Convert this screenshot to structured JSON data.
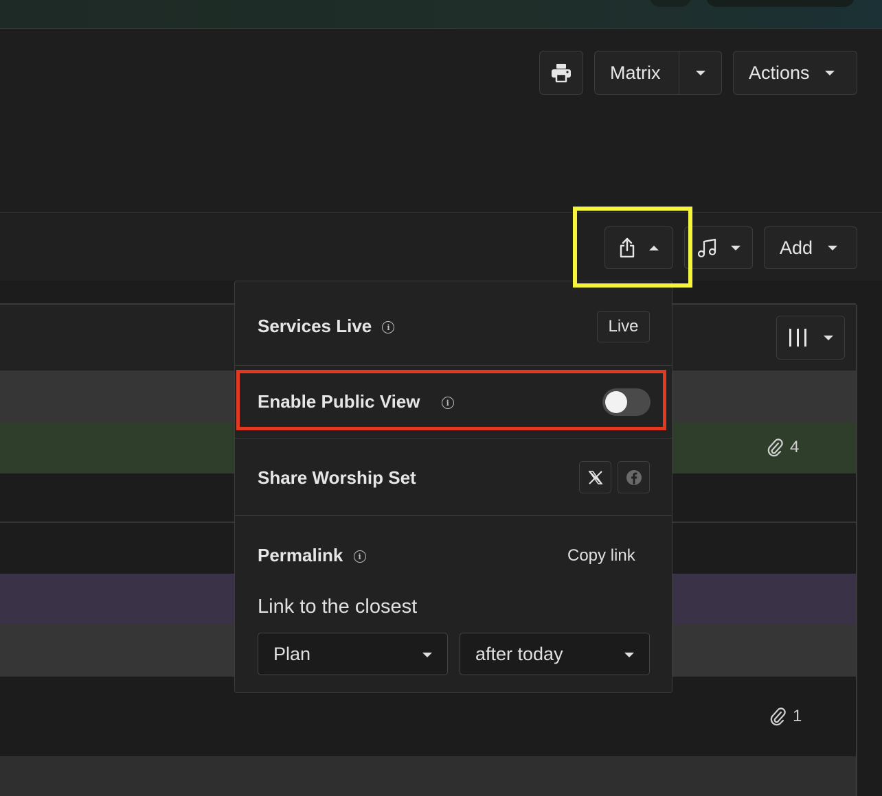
{
  "toolbar": {
    "matrix_label": "Matrix",
    "actions_label": "Actions",
    "add_label": "Add"
  },
  "share_menu": {
    "services_live": {
      "label": "Services Live",
      "button": "Live"
    },
    "public_view": {
      "label": "Enable Public View",
      "enabled": false
    },
    "share_set": {
      "label": "Share Worship Set"
    },
    "permalink": {
      "label": "Permalink",
      "copy_label": "Copy link",
      "closest_label": "Link to the closest",
      "type_select": "Plan",
      "time_select": "after today"
    }
  },
  "table": {
    "attachments": [
      {
        "count": "4"
      },
      {
        "count": "1"
      }
    ]
  },
  "colors": {
    "accent_yellow": "#f5f53b",
    "accent_red": "#e23a22",
    "row_green": "#2f3e2a",
    "row_purple": "#3a3347"
  }
}
